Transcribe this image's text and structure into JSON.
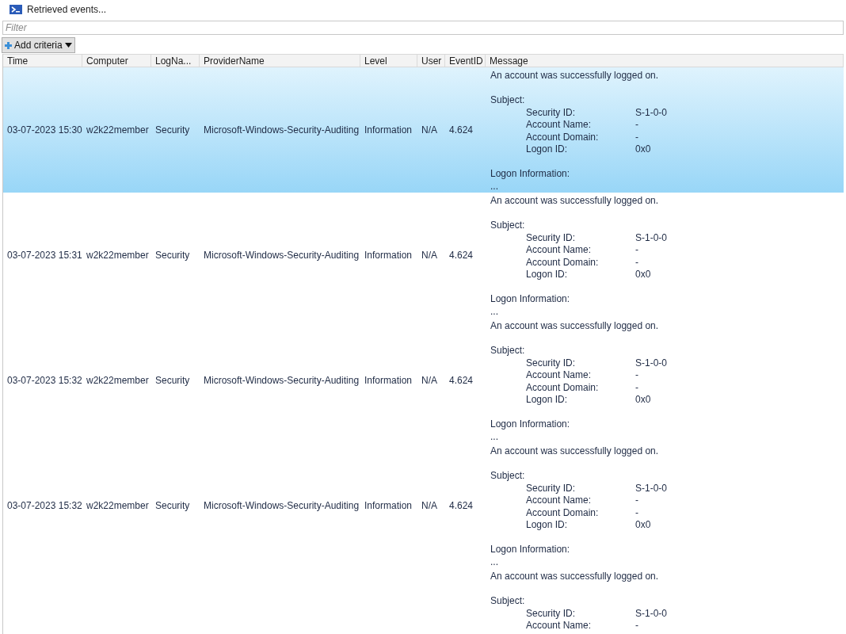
{
  "window": {
    "title": "Retrieved events..."
  },
  "filter": {
    "placeholder": "Filter"
  },
  "add_criteria": {
    "label": "Add criteria"
  },
  "table": {
    "columns": [
      "Time",
      "Computer",
      "LogNa...",
      "ProviderName",
      "Level",
      "User",
      "EventID",
      "Message"
    ],
    "rows": [
      {
        "selected": true,
        "cells": [
          "03-07-2023 15:30",
          "w2k22member",
          "Security",
          "Microsoft-Windows-Security-Auditing",
          "Information",
          "N/A",
          "4.624"
        ],
        "message": {
          "summary": "An account was successfully logged on.",
          "subject": "Subject:",
          "fields": [
            {
              "label": "Security ID:",
              "value": "S-1-0-0"
            },
            {
              "label": "Account Name:",
              "value": "-"
            },
            {
              "label": "Account Domain:",
              "value": "-"
            },
            {
              "label": "Logon ID:",
              "value": "0x0"
            }
          ],
          "logon": "Logon Information:",
          "more": "..."
        }
      },
      {
        "selected": false,
        "cells": [
          "03-07-2023 15:31",
          "w2k22member",
          "Security",
          "Microsoft-Windows-Security-Auditing",
          "Information",
          "N/A",
          "4.624"
        ],
        "message": {
          "summary": "An account was successfully logged on.",
          "subject": "Subject:",
          "fields": [
            {
              "label": "Security ID:",
              "value": "S-1-0-0"
            },
            {
              "label": "Account Name:",
              "value": "-"
            },
            {
              "label": "Account Domain:",
              "value": "-"
            },
            {
              "label": "Logon ID:",
              "value": "0x0"
            }
          ],
          "logon": "Logon Information:",
          "more": "..."
        }
      },
      {
        "selected": false,
        "cells": [
          "03-07-2023 15:32",
          "w2k22member",
          "Security",
          "Microsoft-Windows-Security-Auditing",
          "Information",
          "N/A",
          "4.624"
        ],
        "message": {
          "summary": "An account was successfully logged on.",
          "subject": "Subject:",
          "fields": [
            {
              "label": "Security ID:",
              "value": "S-1-0-0"
            },
            {
              "label": "Account Name:",
              "value": "-"
            },
            {
              "label": "Account Domain:",
              "value": "-"
            },
            {
              "label": "Logon ID:",
              "value": "0x0"
            }
          ],
          "logon": "Logon Information:",
          "more": "..."
        }
      },
      {
        "selected": false,
        "cells": [
          "03-07-2023 15:32",
          "w2k22member",
          "Security",
          "Microsoft-Windows-Security-Auditing",
          "Information",
          "N/A",
          "4.624"
        ],
        "message": {
          "summary": "An account was successfully logged on.",
          "subject": "Subject:",
          "fields": [
            {
              "label": "Security ID:",
              "value": "S-1-0-0"
            },
            {
              "label": "Account Name:",
              "value": "-"
            },
            {
              "label": "Account Domain:",
              "value": "-"
            },
            {
              "label": "Logon ID:",
              "value": "0x0"
            }
          ],
          "logon": "Logon Information:",
          "more": "..."
        }
      },
      {
        "selected": false,
        "message": {
          "summary": "An account was successfully logged on.",
          "subject": "Subject:",
          "fields": [
            {
              "label": "Security ID:",
              "value": "S-1-0-0"
            },
            {
              "label": "Account Name:",
              "value": "-"
            }
          ]
        }
      }
    ]
  }
}
